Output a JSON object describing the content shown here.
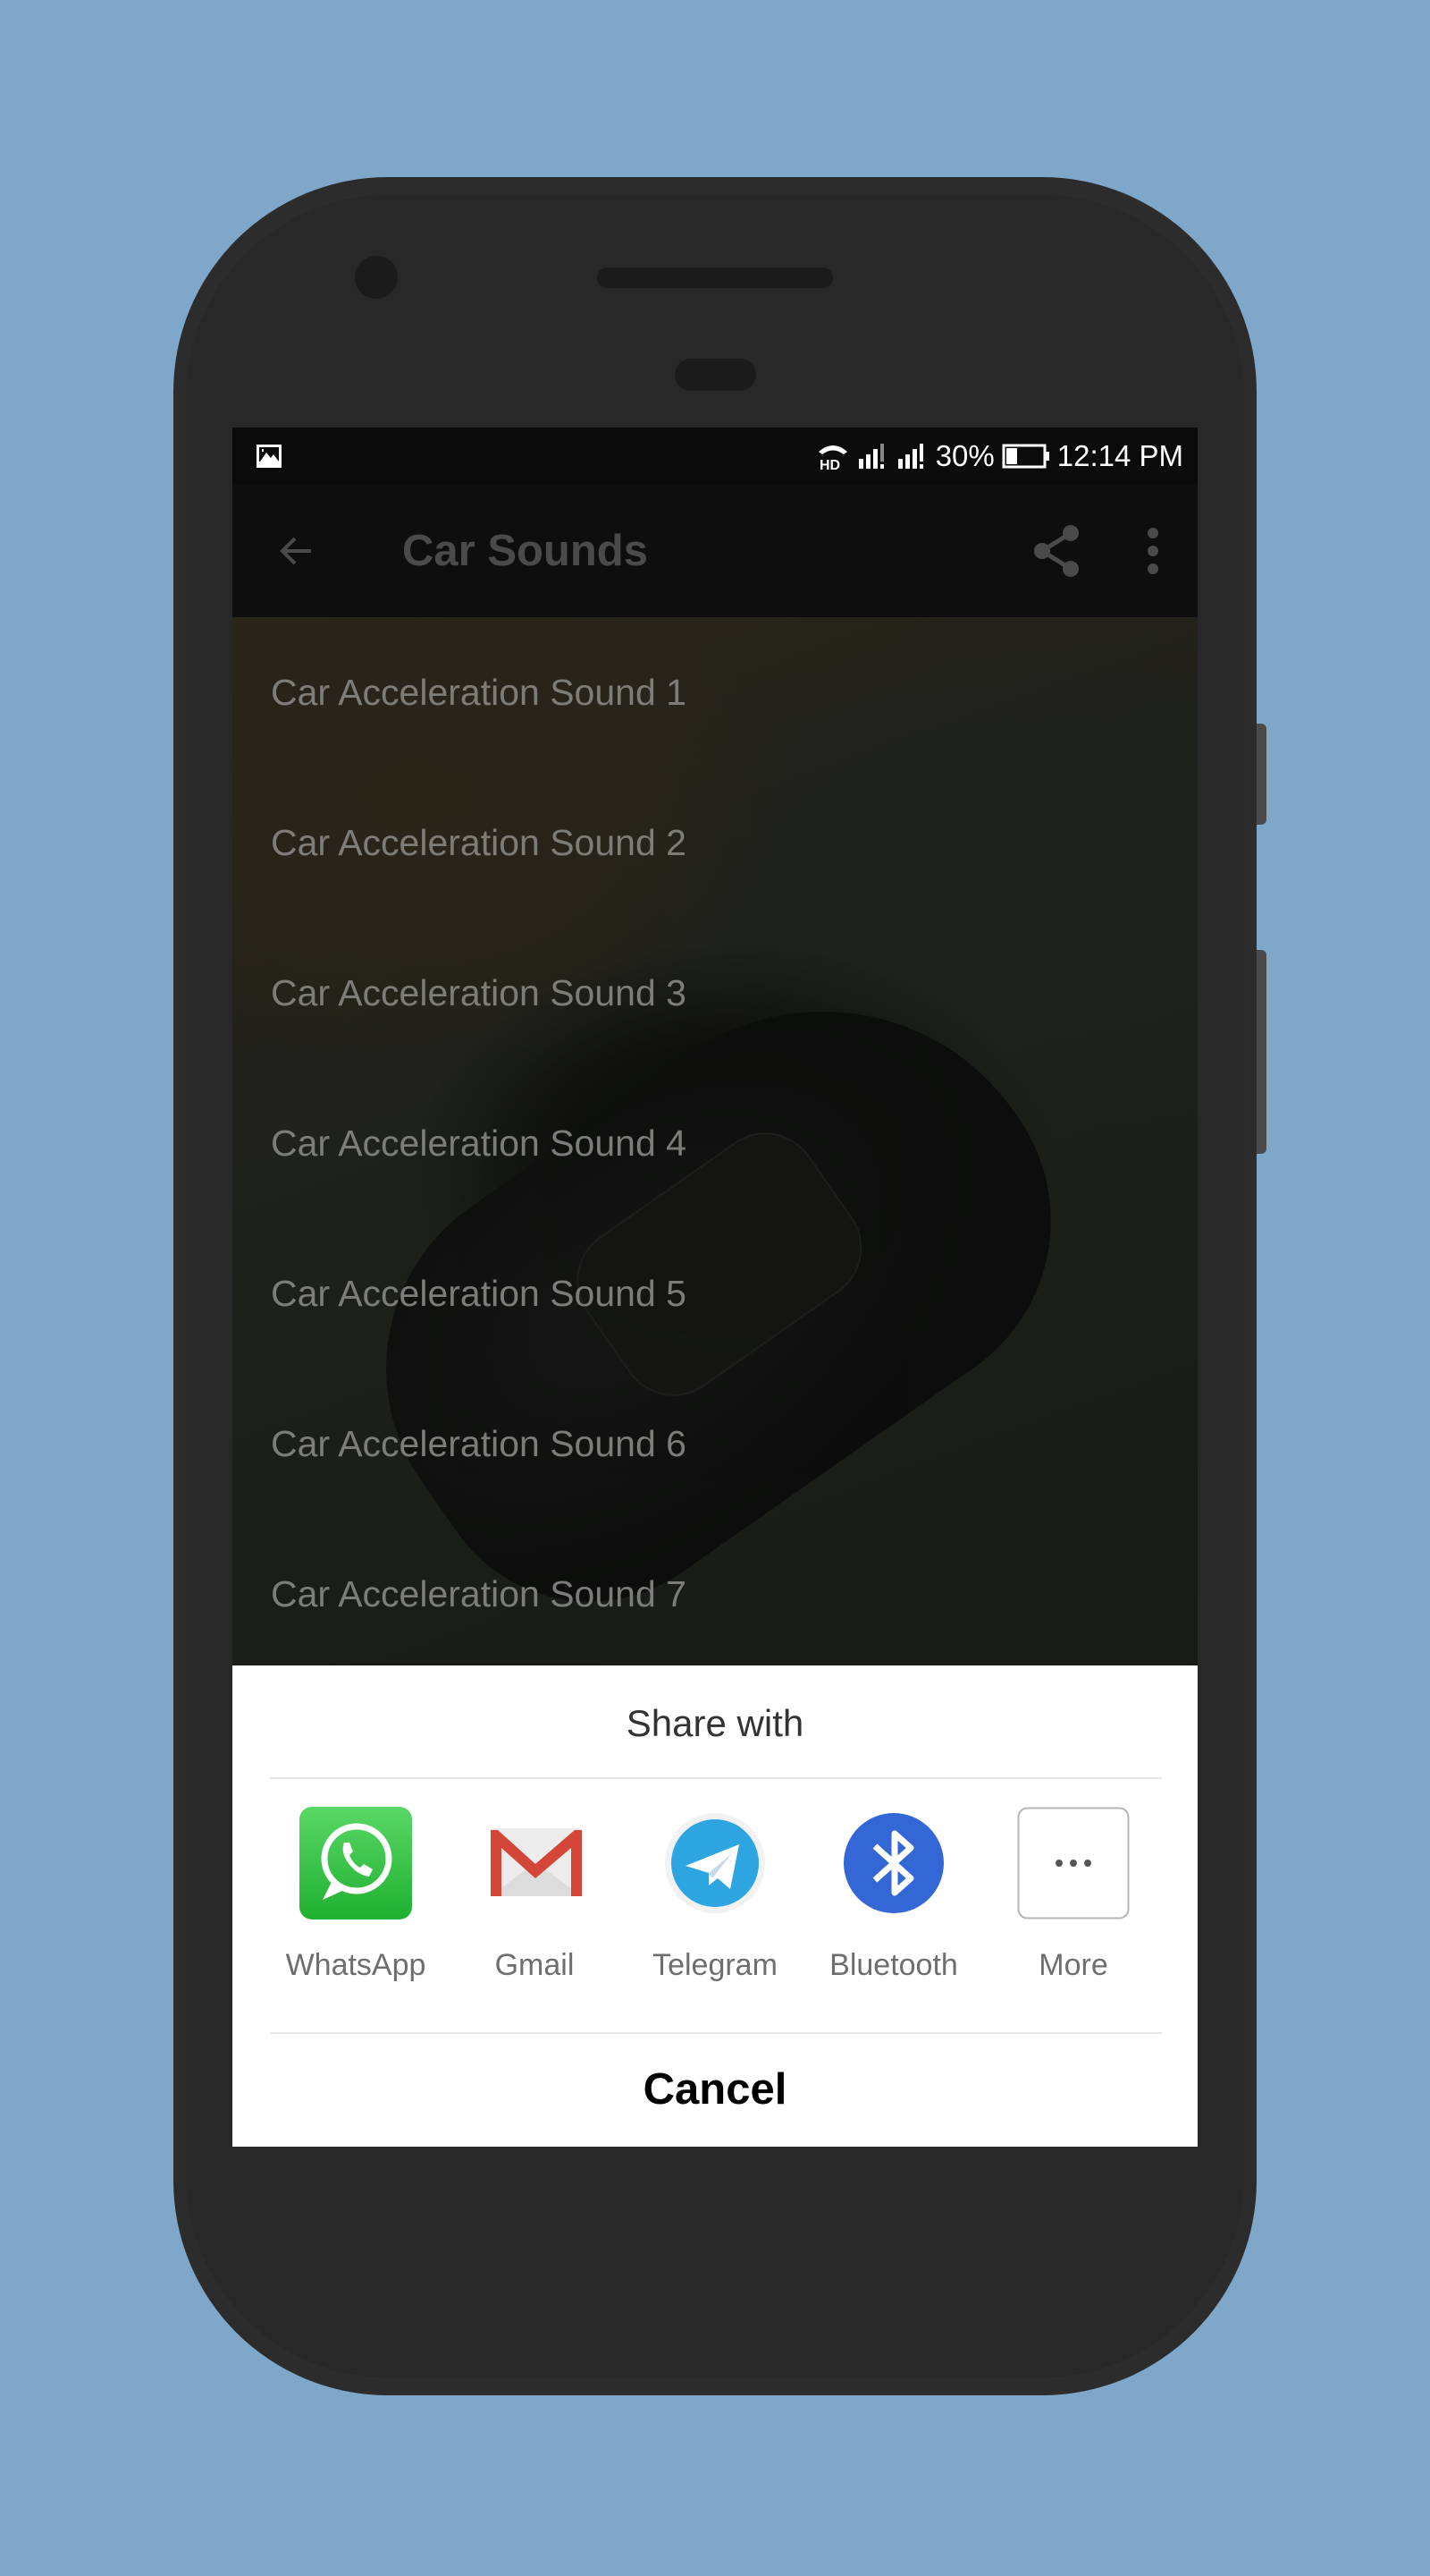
{
  "status_bar": {
    "notification_icon": "image-icon",
    "network_icons": [
      "hd-call-icon",
      "signal-sim1-icon",
      "signal-sim2-icon"
    ],
    "battery_percent": "30%",
    "battery_icon": "battery-icon",
    "time": "12:14 PM"
  },
  "app_bar": {
    "back_icon": "arrow-back-icon",
    "title": "Car Sounds",
    "share_icon": "share-icon",
    "more_icon": "more-vert-icon"
  },
  "sound_list": [
    {
      "label": "Car Acceleration Sound 1"
    },
    {
      "label": "Car Acceleration Sound 2"
    },
    {
      "label": "Car Acceleration Sound 3"
    },
    {
      "label": "Car Acceleration Sound 4"
    },
    {
      "label": "Car Acceleration Sound 5"
    },
    {
      "label": "Car Acceleration Sound 6"
    },
    {
      "label": "Car Acceleration Sound 7"
    }
  ],
  "share_sheet": {
    "title": "Share with",
    "apps": [
      {
        "label": "WhatsApp",
        "icon": "whatsapp-icon",
        "color": "#25c23f"
      },
      {
        "label": "Gmail",
        "icon": "gmail-icon",
        "color": "#d44638"
      },
      {
        "label": "Telegram",
        "icon": "telegram-icon",
        "color": "#2ca5e0"
      },
      {
        "label": "Bluetooth",
        "icon": "bluetooth-icon",
        "color": "#3367d6"
      },
      {
        "label": "More",
        "icon": "more-horiz-icon",
        "color": "#ffffff"
      }
    ],
    "cancel_label": "Cancel"
  },
  "colors": {
    "background": "#7fa7c9",
    "phone_body": "#2c2c2c"
  }
}
